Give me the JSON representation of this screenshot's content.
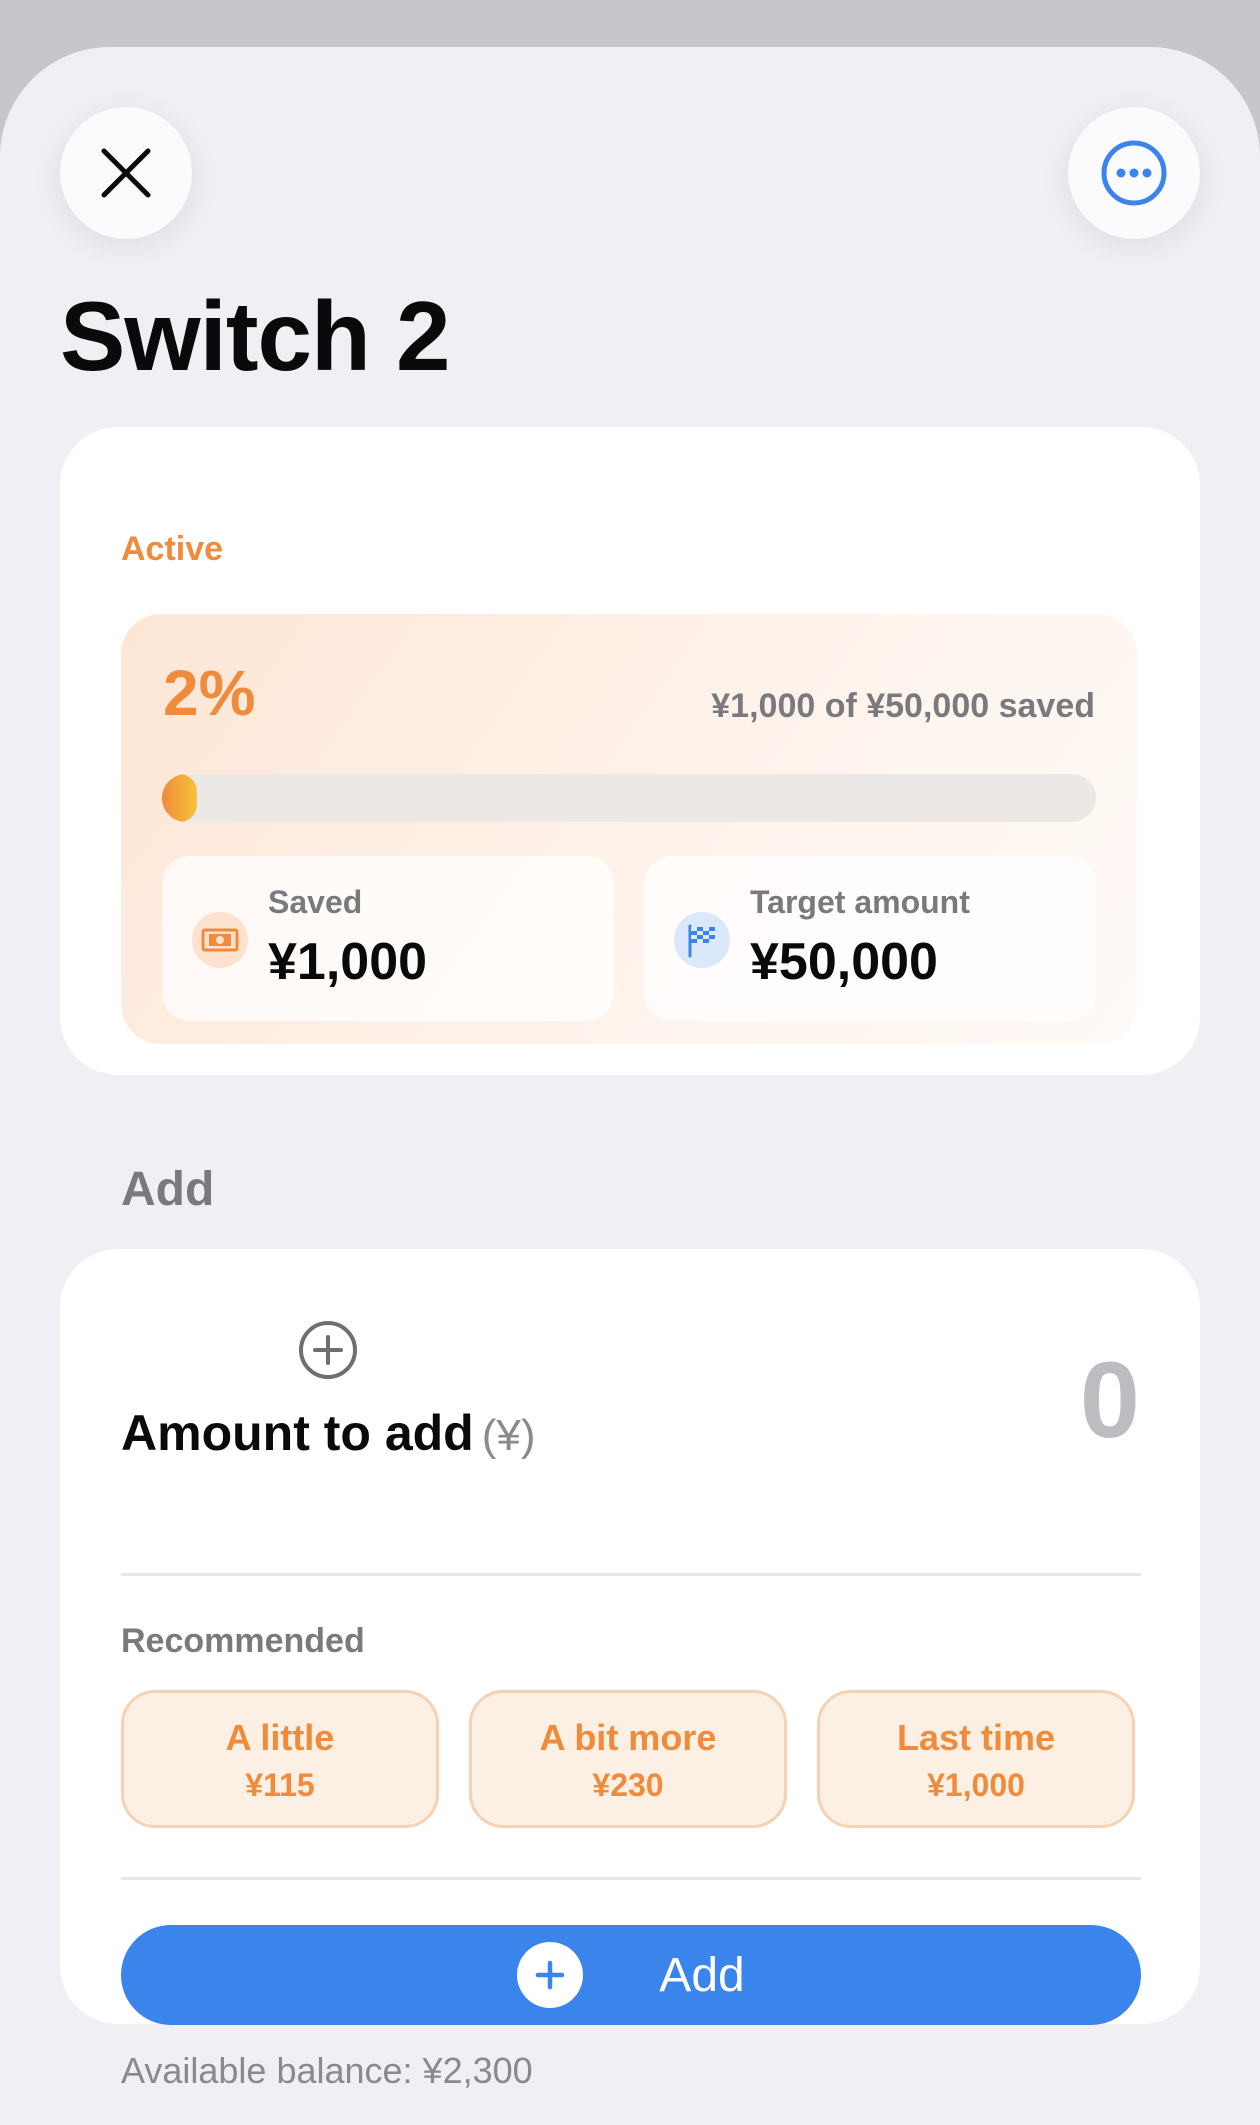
{
  "header": {
    "title": "Switch 2"
  },
  "status": {
    "label": "Active",
    "percent": "2%",
    "summary": "¥1,000 of ¥50,000 saved",
    "progress_fraction": 0.02,
    "saved": {
      "label": "Saved",
      "value": "¥1,000",
      "icon": "banknote-icon"
    },
    "target": {
      "label": "Target amount",
      "value": "¥50,000",
      "icon": "checkered-flag-icon"
    }
  },
  "add_section": {
    "label": "Add",
    "amount_label": "Amount to add",
    "amount_unit": "(¥)",
    "amount_value": "0",
    "recommended_label": "Recommended",
    "recommended": [
      {
        "name": "A little",
        "amount": "¥115"
      },
      {
        "name": "A bit more",
        "amount": "¥230"
      },
      {
        "name": "Last time",
        "amount": "¥1,000"
      }
    ],
    "add_button_label": "Add"
  },
  "footer": {
    "balance": "Available balance: ¥2,300"
  },
  "colors": {
    "accent_orange": "#ef8b3a",
    "accent_blue": "#3a84ec",
    "background": "#efeff4"
  }
}
